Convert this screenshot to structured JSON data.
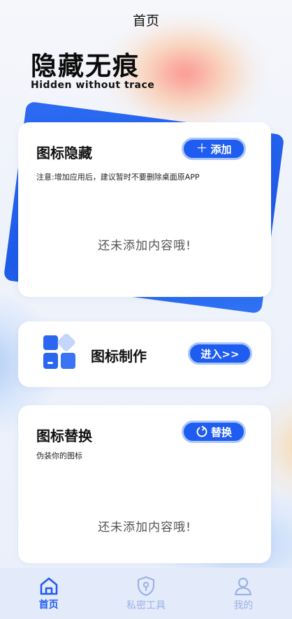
{
  "topbar": {
    "title": "首页"
  },
  "hero": {
    "title": "隐藏无痕",
    "subtitle": "Hidden without trace"
  },
  "icon_hide_card": {
    "title": "图标隐藏",
    "add_button": "添加",
    "add_icon": "plus-icon",
    "note": "注意:增加应用后，建议暂时不要删除桌面原APP",
    "empty_text": "还未添加内容哦!"
  },
  "icon_make_card": {
    "title": "图标制作",
    "enter_button": "进入>>",
    "icon": "app-tiles-icon"
  },
  "icon_replace_card": {
    "title": "图标替换",
    "replace_button": "替换",
    "replace_icon": "refresh-icon",
    "note": "伪装你的图标",
    "empty_text": "还未添加内容哦!"
  },
  "bottom_nav": {
    "items": [
      {
        "label": "首页",
        "icon": "home-icon",
        "active": true
      },
      {
        "label": "私密工具",
        "icon": "shield-icon",
        "active": false
      },
      {
        "label": "我的",
        "icon": "user-icon",
        "active": false
      }
    ]
  },
  "colors": {
    "accent": "#1f5cf0",
    "nav_inactive": "#9bb2e8",
    "nav_background": "#e3eafa"
  }
}
